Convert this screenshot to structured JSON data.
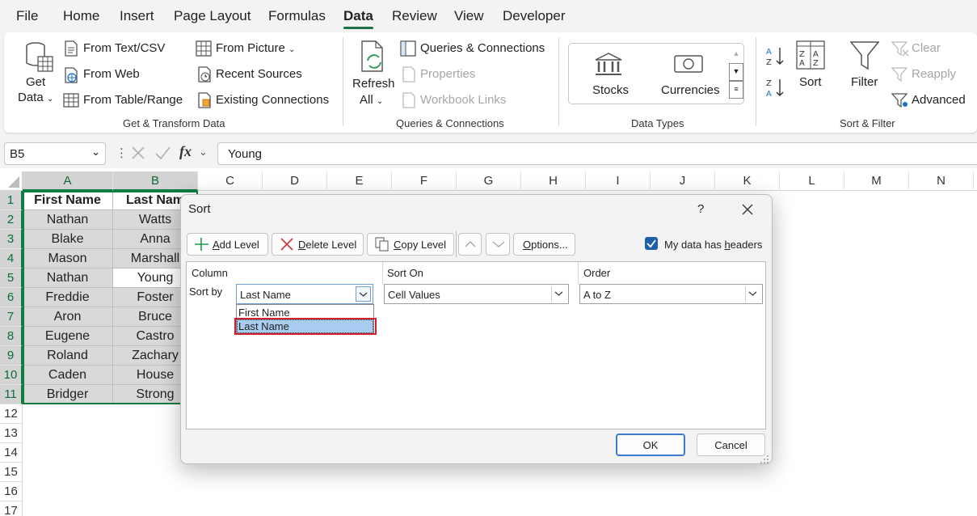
{
  "tabs": [
    "File",
    "Home",
    "Insert",
    "Page Layout",
    "Formulas",
    "Data",
    "Review",
    "View",
    "Developer"
  ],
  "ribbon": {
    "get_data": [
      "Get",
      "Data"
    ],
    "from_text_csv": "From Text/CSV",
    "from_web": "From Web",
    "from_table_range": "From Table/Range",
    "from_picture": "From Picture",
    "recent_sources": "Recent Sources",
    "existing_connections": "Existing Connections",
    "group_get_transform": "Get & Transform Data",
    "refresh_all": [
      "Refresh",
      "All"
    ],
    "queries_connections": "Queries & Connections",
    "properties": "Properties",
    "workbook_links": "Workbook Links",
    "group_queries": "Queries & Connections",
    "stocks": "Stocks",
    "currencies": "Currencies",
    "group_data_types": "Data Types",
    "sort": "Sort",
    "filter": "Filter",
    "clear": "Clear",
    "reapply": "Reapply",
    "advanced": "Advanced",
    "group_sort_filter": "Sort & Filter",
    "accent": "#1e7145"
  },
  "formula_bar": {
    "name_box": "B5",
    "fx": "fx",
    "value": "Young"
  },
  "columns": [
    "A",
    "B",
    "C",
    "D",
    "E",
    "F",
    "G",
    "H",
    "I",
    "J",
    "K",
    "L",
    "M",
    "N"
  ],
  "rows": [
    "1",
    "2",
    "3",
    "4",
    "5",
    "6",
    "7",
    "8",
    "9",
    "10",
    "11",
    "12",
    "13",
    "14",
    "15",
    "16",
    "17"
  ],
  "table": {
    "headers": [
      "First Name",
      "Last Nam"
    ],
    "first_names": [
      "Nathan",
      "Blake",
      "Mason",
      "Nathan",
      "Freddie",
      "Aron",
      "Eugene",
      "Roland",
      "Caden",
      "Bridger"
    ],
    "last_names": [
      "Watts",
      "Anna",
      "Marshall",
      "Young",
      "Foster",
      "Bruce",
      "Castro",
      "Zachary",
      "House",
      "Strong"
    ]
  },
  "dialog": {
    "title": "Sort",
    "help": "?",
    "add_level": {
      "prefix": "",
      "key": "A",
      "rest": "dd Level"
    },
    "delete_level": {
      "prefix": "",
      "key": "D",
      "rest": "elete Level"
    },
    "copy_level": {
      "prefix": "",
      "key": "C",
      "rest": "opy Level"
    },
    "options": {
      "prefix": "",
      "key": "O",
      "rest": "ptions..."
    },
    "headers_checkbox": {
      "prefix": "My data has ",
      "key": "h",
      "rest": "eaders",
      "checked": true
    },
    "col_header_column": "Column",
    "col_header_sort_on": "Sort On",
    "col_header_order": "Order",
    "sort_by": "Sort by",
    "column_value": "Last Name",
    "sort_on_value": "Cell Values",
    "order_value": "A to Z",
    "dropdown_options": [
      "First Name",
      "Last Name"
    ],
    "ok": "OK",
    "cancel": "Cancel"
  }
}
